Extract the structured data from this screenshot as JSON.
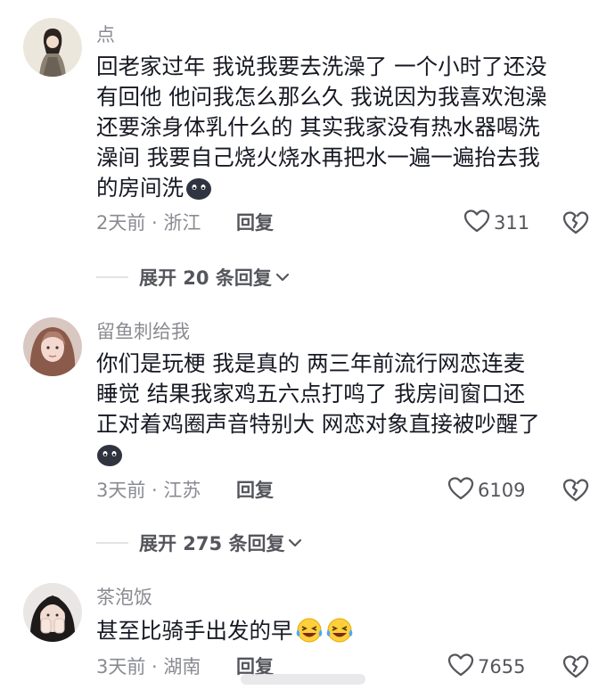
{
  "comments": [
    {
      "username": "点",
      "text_lines": [
        "回老家过年 我说我要去洗澡了 一个小时了还没",
        "有回他 他问我怎么那么久 我说因为我喜欢泡澡",
        "还要涂身体乳什么的 其实我家没有热水器喝洗",
        "澡间 我要自己烧火烧水再把水一遍一遍抬去我",
        "的房间洗"
      ],
      "emoji": "dark-blob-emoji",
      "time_location": "2天前 · 浙江",
      "reply_label": "回复",
      "likes": "311",
      "expand_label": "展开 20 条回复"
    },
    {
      "username": "留鱼刺给我",
      "text_lines": [
        "你们是玩梗  我是真的  两三年前流行网恋连麦",
        "睡觉  结果我家鸡五六点打鸣了  我房间窗口还",
        "正对着鸡圈声音特别大  网恋对象直接被吵醒了",
        ""
      ],
      "emoji": "dark-blob-emoji",
      "time_location": "3天前 · 江苏",
      "reply_label": "回复",
      "likes": "6109",
      "expand_label": "展开 275 条回复"
    },
    {
      "username": "茶泡饭",
      "text_lines": [
        "甚至比骑手出发的早"
      ],
      "emoji": "laughing-crying-emoji",
      "time_location": "3天前 · 湖南",
      "reply_label": "回复",
      "likes": "7655"
    }
  ],
  "colors": {
    "secondary_text": "#8a8b91",
    "primary_text": "#161823",
    "action_text": "#55565c",
    "divider": "#e3e3e5"
  }
}
